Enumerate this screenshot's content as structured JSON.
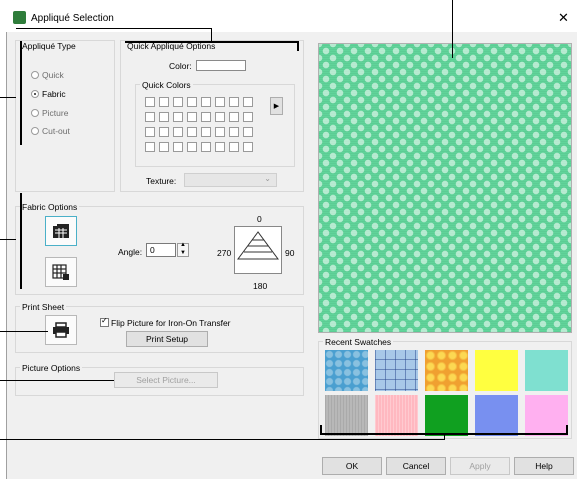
{
  "window": {
    "title": "Appliqué Selection",
    "close_glyph": "✕"
  },
  "applique_type": {
    "label": "Appliqué Type",
    "options": [
      "Quick",
      "Fabric",
      "Picture",
      "Cut-out"
    ],
    "selected": "Fabric"
  },
  "quick_options": {
    "label": "Quick Appliqué  Options",
    "color_label": "Color:",
    "quick_colors_label": "Quick Colors",
    "texture_label": "Texture:",
    "texture_value": ""
  },
  "fabric_options": {
    "label": "Fabric Options",
    "angle_label": "Angle:",
    "angle_value": "0",
    "dial": {
      "top": "0",
      "left": "270",
      "right": "90",
      "bottom": "180"
    }
  },
  "print_sheet": {
    "label": "Print Sheet",
    "flip_label": "Flip Picture for Iron-On Transfer",
    "flip_checked": true,
    "setup_button": "Print Setup"
  },
  "picture_options": {
    "label": "Picture Options",
    "select_button": "Select Picture..."
  },
  "recent_swatches": {
    "label": "Recent Swatches",
    "colors": [
      "#4a9fd0",
      "#a8c8e8",
      "#f0a030",
      "#ffff40",
      "#7fe0d0",
      "#b8b8b8",
      "#ffb8c0",
      "#10a020",
      "#7890f0",
      "#ffb0f0"
    ]
  },
  "buttons": {
    "ok": "OK",
    "cancel": "Cancel",
    "apply": "Apply",
    "help": "Help"
  },
  "colors": {
    "preview_green": "#60d49a",
    "dialog_bg": "#f0f0f0"
  }
}
